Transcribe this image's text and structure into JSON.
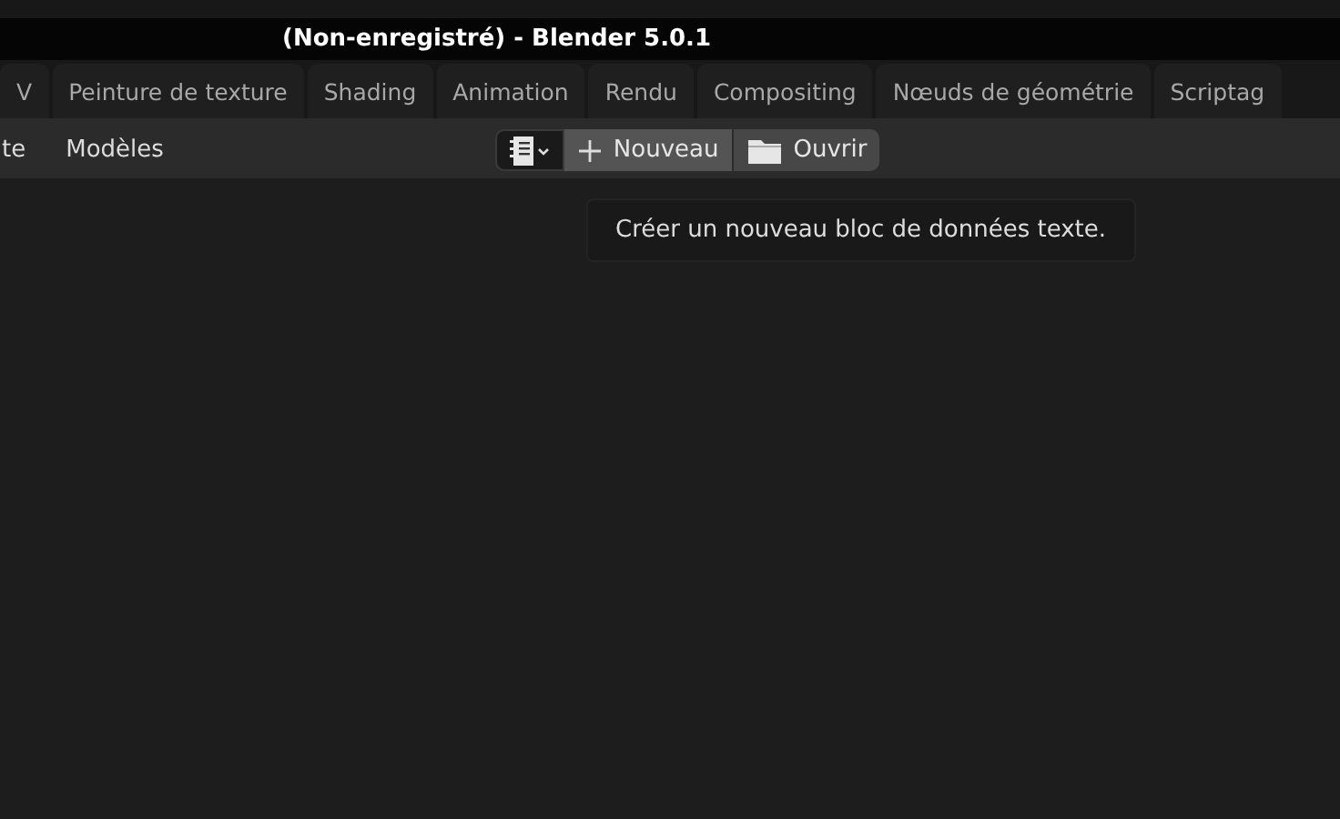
{
  "window": {
    "title": "(Non-enregistré) - Blender 5.0.1"
  },
  "workspace_tabs": [
    {
      "label": "V",
      "selected": false
    },
    {
      "label": "Peinture de texture",
      "selected": false
    },
    {
      "label": "Shading",
      "selected": false
    },
    {
      "label": "Animation",
      "selected": false
    },
    {
      "label": "Rendu",
      "selected": false
    },
    {
      "label": "Compositing",
      "selected": false
    },
    {
      "label": "Nœuds de géométrie",
      "selected": false
    },
    {
      "label": "Scriptag",
      "selected": false
    }
  ],
  "header": {
    "menus": [
      "te",
      "Modèles"
    ],
    "new_button": "Nouveau",
    "open_button": "Ouvrir"
  },
  "tooltip": {
    "text": "Créer un nouveau bloc de données texte."
  }
}
